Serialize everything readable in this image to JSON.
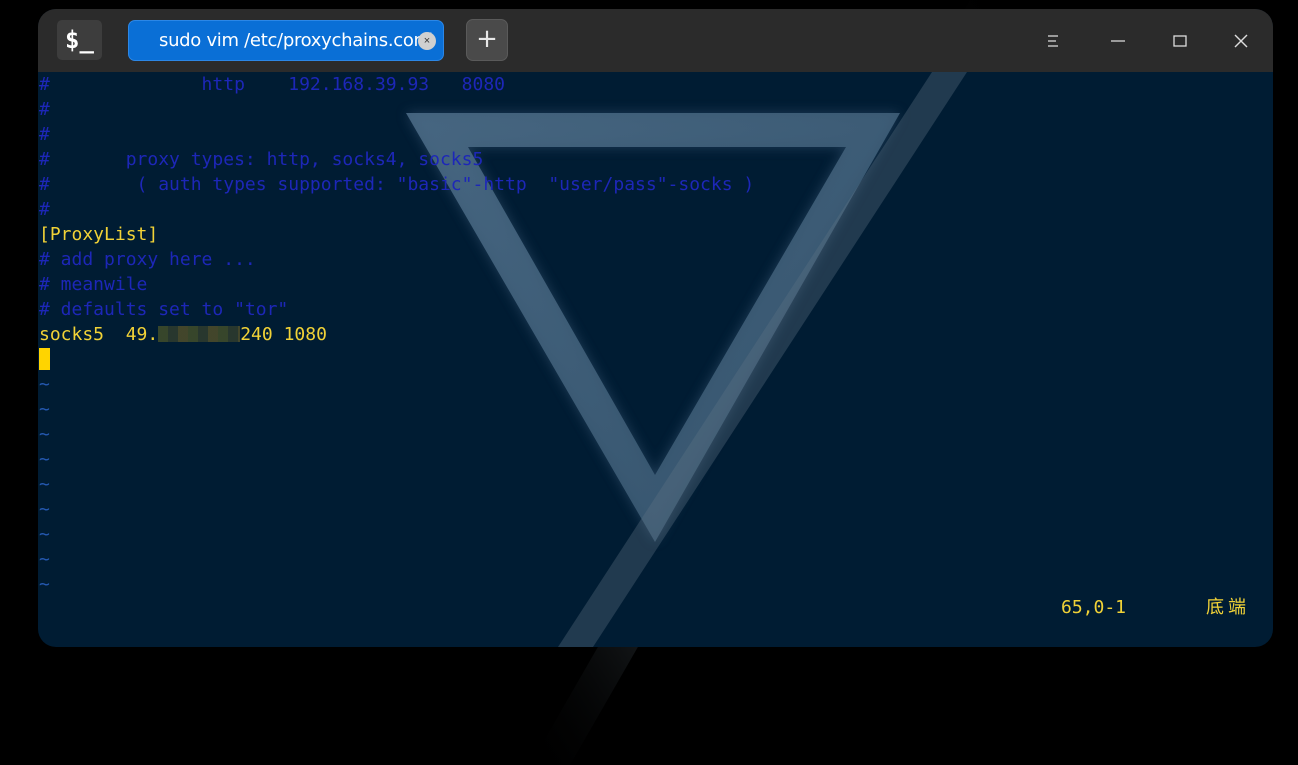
{
  "app": {
    "icon_label": "$_",
    "tab_title": "sudo vim /etc/proxychains.conf",
    "tab_close_glyph": "×",
    "new_tab_glyph": "+"
  },
  "window_controls": {
    "menu": "menu-icon",
    "minimize": "minimize-icon",
    "maximize": "maximize-icon",
    "close": "close-icon"
  },
  "terminal": {
    "lines": [
      {
        "text": "#              http    192.168.39.93   8080",
        "style": "comment"
      },
      {
        "text": "#",
        "style": "comment"
      },
      {
        "text": "#",
        "style": "comment"
      },
      {
        "text": "#       proxy types: http, socks4, socks5",
        "style": "comment"
      },
      {
        "text": "#        ( auth types supported: \"basic\"-http  \"user/pass\"-socks )",
        "style": "comment"
      },
      {
        "text": "#",
        "style": "comment"
      },
      {
        "text": "[ProxyList]",
        "style": "yellow"
      },
      {
        "text": "# add proxy here ...",
        "style": "comment"
      },
      {
        "text": "# meanwile",
        "style": "comment"
      },
      {
        "text": "# defaults set to \"tor\"",
        "style": "comment"
      }
    ],
    "proxy_line": {
      "prefix": "socks5  49.",
      "suffix": "240 1080"
    },
    "tildes": [
      "~",
      "~",
      "~",
      "~",
      "~",
      "~",
      "~",
      "~",
      "~"
    ],
    "status_position": "65,0-1",
    "status_where": "底端"
  },
  "colors": {
    "comment": "#1d27b8",
    "keyword": "#f1d237",
    "cursor": "#ffd400",
    "background": "#001c33",
    "tab_accent": "#0a6fd6"
  }
}
